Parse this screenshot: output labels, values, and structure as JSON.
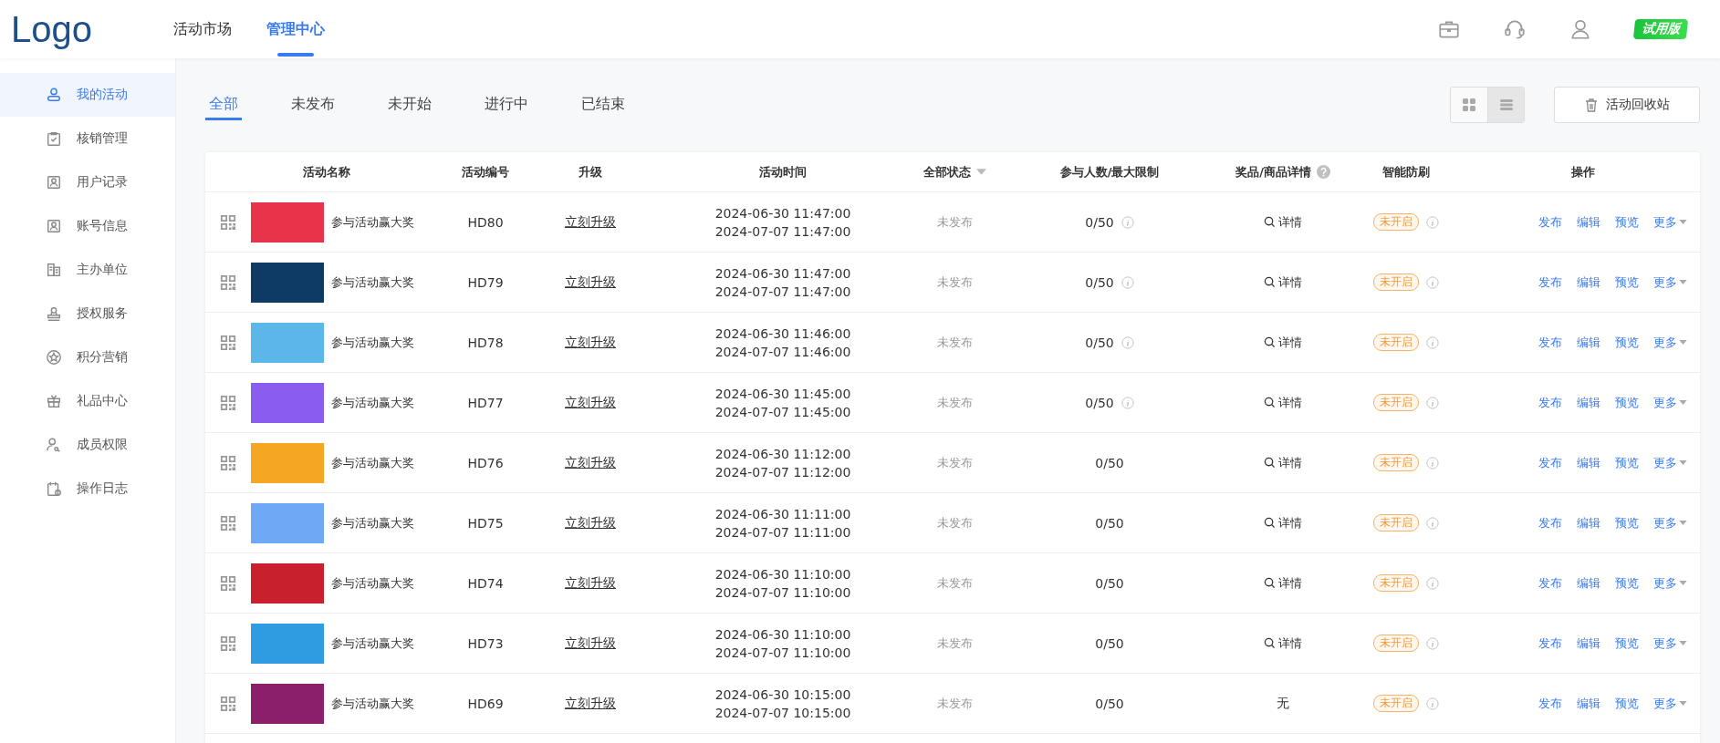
{
  "logo": "Logo",
  "top_nav": [
    {
      "label": "活动市场",
      "selected": false
    },
    {
      "label": "管理中心",
      "selected": true
    }
  ],
  "trial_badge": "试用版",
  "sidebar": [
    {
      "label": "我的活动",
      "selected": true
    },
    {
      "label": "核销管理",
      "selected": false
    },
    {
      "label": "用户记录",
      "selected": false
    },
    {
      "label": "账号信息",
      "selected": false
    },
    {
      "label": "主办单位",
      "selected": false
    },
    {
      "label": "授权服务",
      "selected": false
    },
    {
      "label": "积分营销",
      "selected": false
    },
    {
      "label": "礼品中心",
      "selected": false
    },
    {
      "label": "成员权限",
      "selected": false
    },
    {
      "label": "操作日志",
      "selected": false
    }
  ],
  "filter_tabs": [
    {
      "label": "全部",
      "selected": true
    },
    {
      "label": "未发布",
      "selected": false
    },
    {
      "label": "未开始",
      "selected": false
    },
    {
      "label": "进行中",
      "selected": false
    },
    {
      "label": "已结束",
      "selected": false
    }
  ],
  "view_toggle": [
    {
      "kind": "grid",
      "selected": false
    },
    {
      "kind": "list",
      "selected": true
    }
  ],
  "recycle_button": "活动回收站",
  "table": {
    "columns": [
      "活动名称",
      "活动编号",
      "升级",
      "活动时间",
      "全部状态",
      "参与人数/最大限制",
      "奖品/商品详情",
      "智能防刷",
      "操作"
    ],
    "rows": [
      {
        "name": "参与活动赢大奖",
        "code": "HD80",
        "upgrade": "立刻升级",
        "start": "2024-06-30 11:47:00",
        "end": "2024-07-07 11:47:00",
        "status": "未发布",
        "count": "0/50",
        "count_info": true,
        "prize": "详情",
        "prize_link": true,
        "guard": "未开启",
        "actions": [
          "发布",
          "编辑",
          "预览",
          "更多"
        ]
      },
      {
        "name": "参与活动赢大奖",
        "code": "HD79",
        "upgrade": "立刻升级",
        "start": "2024-06-30 11:47:00",
        "end": "2024-07-07 11:47:00",
        "status": "未发布",
        "count": "0/50",
        "count_info": true,
        "prize": "详情",
        "prize_link": true,
        "guard": "未开启",
        "actions": [
          "发布",
          "编辑",
          "预览",
          "更多"
        ]
      },
      {
        "name": "参与活动赢大奖",
        "code": "HD78",
        "upgrade": "立刻升级",
        "start": "2024-06-30 11:46:00",
        "end": "2024-07-07 11:46:00",
        "status": "未发布",
        "count": "0/50",
        "count_info": true,
        "prize": "详情",
        "prize_link": true,
        "guard": "未开启",
        "actions": [
          "发布",
          "编辑",
          "预览",
          "更多"
        ]
      },
      {
        "name": "参与活动赢大奖",
        "code": "HD77",
        "upgrade": "立刻升级",
        "start": "2024-06-30 11:45:00",
        "end": "2024-07-07 11:45:00",
        "status": "未发布",
        "count": "0/50",
        "count_info": true,
        "prize": "详情",
        "prize_link": true,
        "guard": "未开启",
        "actions": [
          "发布",
          "编辑",
          "预览",
          "更多"
        ]
      },
      {
        "name": "参与活动赢大奖",
        "code": "HD76",
        "upgrade": "立刻升级",
        "start": "2024-06-30 11:12:00",
        "end": "2024-07-07 11:12:00",
        "status": "未发布",
        "count": "0/50",
        "count_info": false,
        "prize": "详情",
        "prize_link": true,
        "guard": "未开启",
        "actions": [
          "发布",
          "编辑",
          "预览",
          "更多"
        ]
      },
      {
        "name": "参与活动赢大奖",
        "code": "HD75",
        "upgrade": "立刻升级",
        "start": "2024-06-30 11:11:00",
        "end": "2024-07-07 11:11:00",
        "status": "未发布",
        "count": "0/50",
        "count_info": false,
        "prize": "详情",
        "prize_link": true,
        "guard": "未开启",
        "actions": [
          "发布",
          "编辑",
          "预览",
          "更多"
        ]
      },
      {
        "name": "参与活动赢大奖",
        "code": "HD74",
        "upgrade": "立刻升级",
        "start": "2024-06-30 11:10:00",
        "end": "2024-07-07 11:10:00",
        "status": "未发布",
        "count": "0/50",
        "count_info": false,
        "prize": "详情",
        "prize_link": true,
        "guard": "未开启",
        "actions": [
          "发布",
          "编辑",
          "预览",
          "更多"
        ]
      },
      {
        "name": "参与活动赢大奖",
        "code": "HD73",
        "upgrade": "立刻升级",
        "start": "2024-06-30 11:10:00",
        "end": "2024-07-07 11:10:00",
        "status": "未发布",
        "count": "0/50",
        "count_info": false,
        "prize": "详情",
        "prize_link": true,
        "guard": "未开启",
        "actions": [
          "发布",
          "编辑",
          "预览",
          "更多"
        ]
      },
      {
        "name": "参与活动赢大奖",
        "code": "HD69",
        "upgrade": "立刻升级",
        "start": "2024-06-30 10:15:00",
        "end": "2024-07-07 10:15:00",
        "status": "未发布",
        "count": "0/50",
        "count_info": false,
        "prize": "无",
        "prize_link": false,
        "guard": "未开启",
        "actions": [
          "发布",
          "编辑",
          "预览",
          "更多"
        ]
      }
    ]
  }
}
